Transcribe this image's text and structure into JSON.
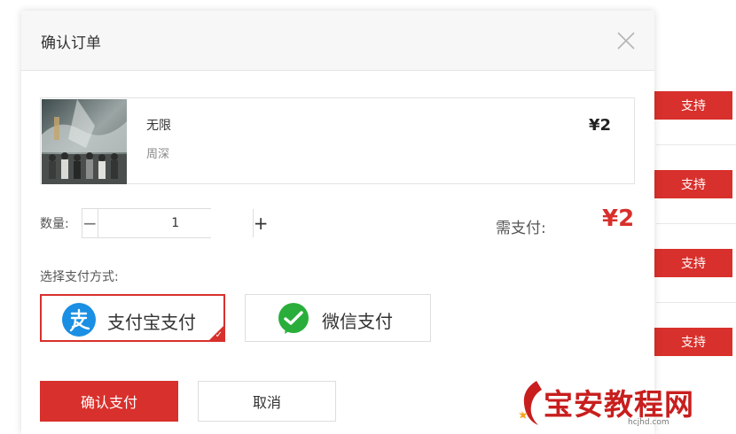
{
  "background": {
    "support_buttons": [
      "支持",
      "支持",
      "支持",
      "支持"
    ]
  },
  "dialog": {
    "title": "确认订单",
    "close_icon": "close-icon",
    "product": {
      "name": "无限",
      "artist": "周深",
      "price": "¥2"
    },
    "quantity": {
      "label": "数量:",
      "value": "1",
      "minus": "−",
      "plus": "+"
    },
    "payment_due": {
      "label": "需支付:",
      "amount": "¥2"
    },
    "payment_methods": {
      "label": "选择支付方式:",
      "options": [
        {
          "label": "支付宝支付",
          "icon": "alipay-icon",
          "selected": true
        },
        {
          "label": "微信支付",
          "icon": "wechat-icon",
          "selected": false
        }
      ]
    },
    "buttons": {
      "confirm": "确认支付",
      "cancel": "取消"
    }
  },
  "watermark": {
    "text": "宝安教程网",
    "sub": "hcjhd.com"
  },
  "colors": {
    "accent": "#d8302c",
    "alipay": "#1a8fe3",
    "wechat": "#2aae3b"
  }
}
